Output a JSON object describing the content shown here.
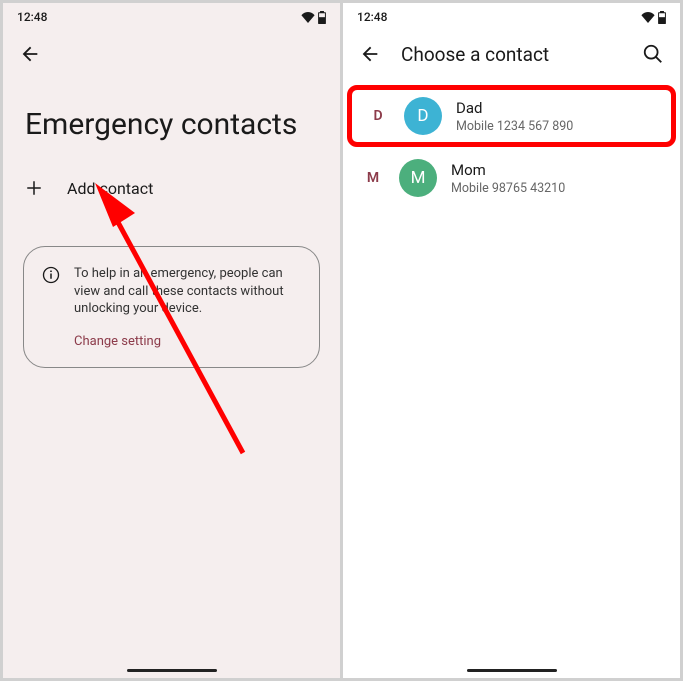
{
  "statusbar": {
    "time": "12:48"
  },
  "left": {
    "heading": "Emergency contacts",
    "add_label": "Add contact",
    "info_text": "To help in an emergency, people can view and call these contacts without unlocking your device.",
    "change_link": "Change setting"
  },
  "right": {
    "title": "Choose a contact",
    "contacts": [
      {
        "letter": "D",
        "name": "Dad",
        "sub": "Mobile 1234 567 890",
        "avatar_color": "#3db3d4"
      },
      {
        "letter": "M",
        "name": "Mom",
        "sub": "Mobile 98765 43210",
        "avatar_color": "#4caf7d"
      }
    ]
  }
}
